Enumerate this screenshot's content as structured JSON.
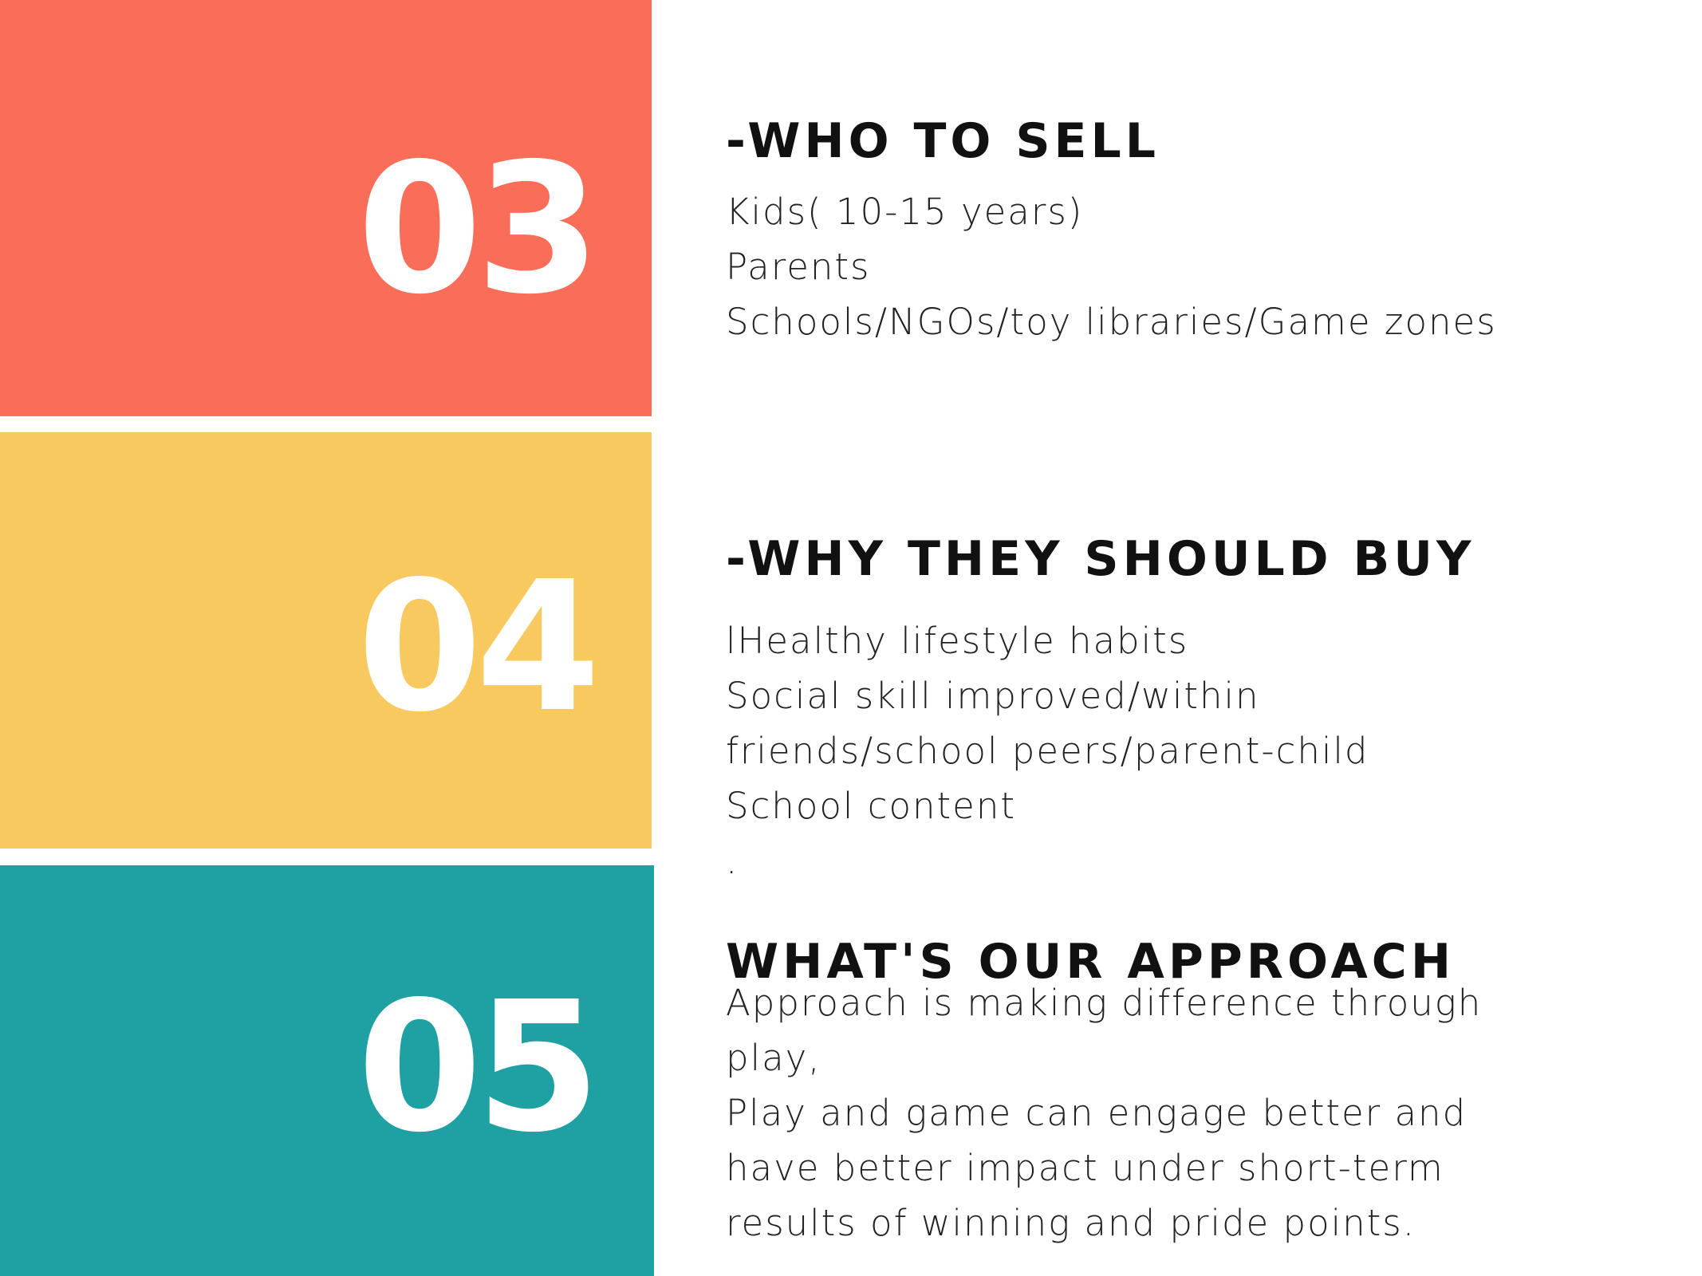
{
  "colors": {
    "block_03": "#FA6D59",
    "block_04": "#F8C95F",
    "block_05": "#1FA1A4",
    "number_text": "#FFFFFF",
    "heading_text": "#111111",
    "body_text": "#222222",
    "background": "#FFFFFF"
  },
  "sections": [
    {
      "number": "03",
      "heading": "-WHO TO SELL",
      "lines": [
        "Kids( 10-15 years)",
        "Parents",
        "Schools/NGOs/toy libraries/Game zones"
      ]
    },
    {
      "number": "04",
      "heading": "-WHY THEY SHOULD BUY",
      "lines": [
        "lHealthy lifestyle habits",
        "Social skill improved/within",
        "friends/school peers/parent-child",
        "School content",
        "."
      ]
    },
    {
      "number": "05",
      "heading": "WHAT'S OUR APPROACH",
      "lines": [
        "Approach is making difference through",
        "play,",
        "Play and game can engage better and",
        "have better impact under short-term",
        "results of winning and pride points."
      ]
    }
  ]
}
